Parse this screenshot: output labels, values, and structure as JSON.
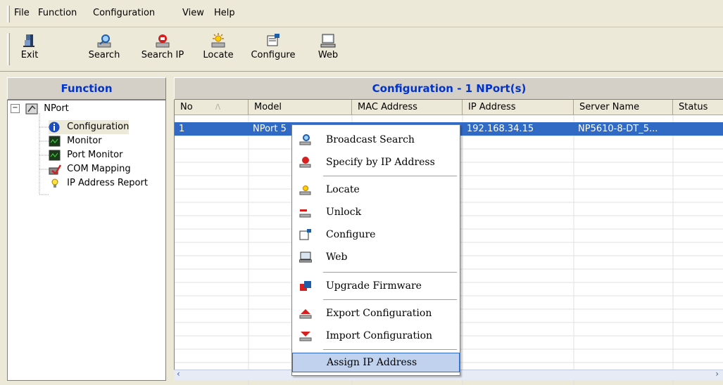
{
  "menu": {
    "items": [
      "File",
      "Function",
      "Configuration",
      "View",
      "Help"
    ]
  },
  "toolbar": {
    "exit_label": "Exit",
    "search_label": "Search",
    "search_ip_label": "Search IP",
    "locate_label": "Locate",
    "configure_label": "Configure",
    "web_label": "Web"
  },
  "left_panel": {
    "title": "Function",
    "tree": {
      "root": "NPort",
      "children": [
        "Configuration",
        "Monitor",
        "Port Monitor",
        "COM Mapping",
        "IP Address Report"
      ]
    }
  },
  "right_panel": {
    "title": "Configuration - 1 NPort(s)",
    "columns": [
      "No",
      "Model",
      "MAC Address",
      "IP Address",
      "Server Name",
      "Status"
    ],
    "sort_indicator": "/\\",
    "rows": [
      {
        "no": "1",
        "model": "NPort 5",
        "mac": "",
        "ip": "192.168.34.15",
        "server_name": "NP5610-8-DT_5...",
        "status": ""
      }
    ]
  },
  "context_menu": {
    "items": [
      {
        "label": "Broadcast Search",
        "icon": "search-icon"
      },
      {
        "label": "Specify by IP Address",
        "icon": "search-ip-icon"
      },
      {
        "label": "Locate",
        "icon": "locate-icon"
      },
      {
        "label": "Unlock",
        "icon": "unlock-icon"
      },
      {
        "label": "Configure",
        "icon": "configure-icon"
      },
      {
        "label": "Web",
        "icon": "web-icon"
      },
      {
        "label": "Upgrade Firmware",
        "icon": "upgrade-firmware-icon"
      },
      {
        "label": "Export Configuration",
        "icon": "export-icon"
      },
      {
        "label": "Import Configuration",
        "icon": "import-icon"
      },
      {
        "label": "Assign IP Address",
        "icon": ""
      }
    ],
    "highlighted": "Assign IP Address"
  },
  "colors": {
    "selection": "#316ac5",
    "panel_title": "#0033cc",
    "highlight": "#c1d2ee"
  }
}
